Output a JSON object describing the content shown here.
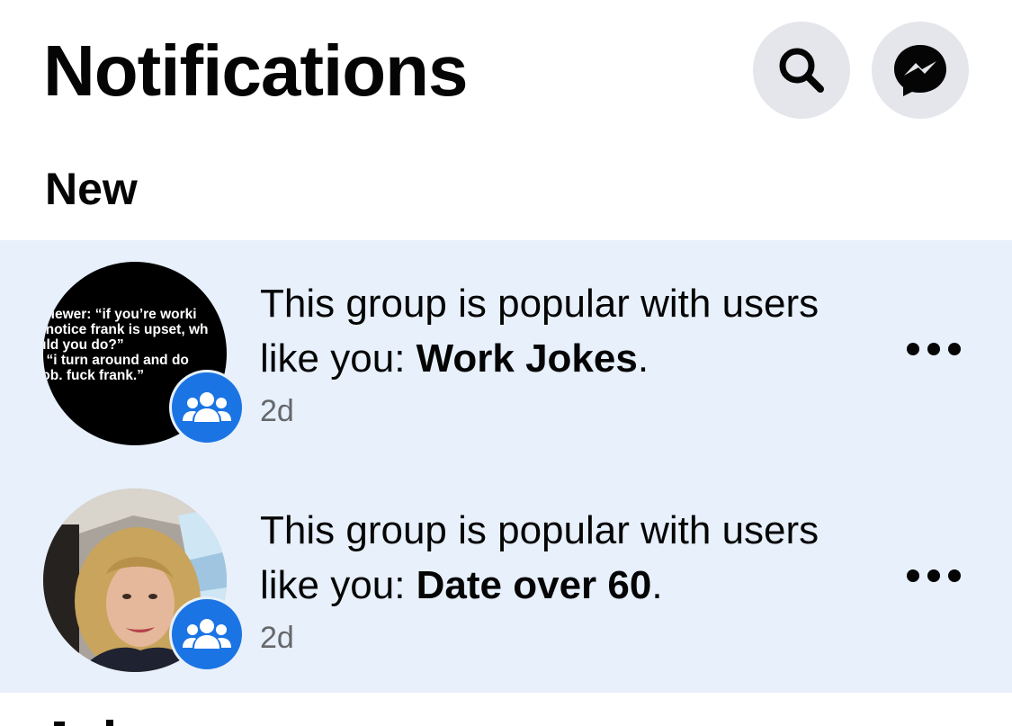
{
  "header": {
    "title": "Notifications",
    "search_icon": "search-icon",
    "messenger_icon": "messenger-icon"
  },
  "sections": {
    "new_title": "New"
  },
  "notifications": [
    {
      "prefix": "This group is popular with users like you: ",
      "group": "Work Jokes",
      "suffix": ".",
      "time": "2d",
      "avatar_text": "rviewer: “if you’re worki\nl notice frank is upset, wh\nuld you do?”\n: “i turn around and do\njob. fuck frank.”",
      "badge_icon": "group-icon",
      "more_icon": "more-options-icon"
    },
    {
      "prefix": "This group is popular with users like you: ",
      "group": "Date over 60",
      "suffix": ".",
      "time": "2d",
      "badge_icon": "group-icon",
      "more_icon": "more-options-icon"
    }
  ],
  "colors": {
    "unread_bg": "#e7f0fb",
    "badge_blue": "#1b74e4",
    "button_bg": "#e4e6eb",
    "secondary_text": "#65676b"
  }
}
